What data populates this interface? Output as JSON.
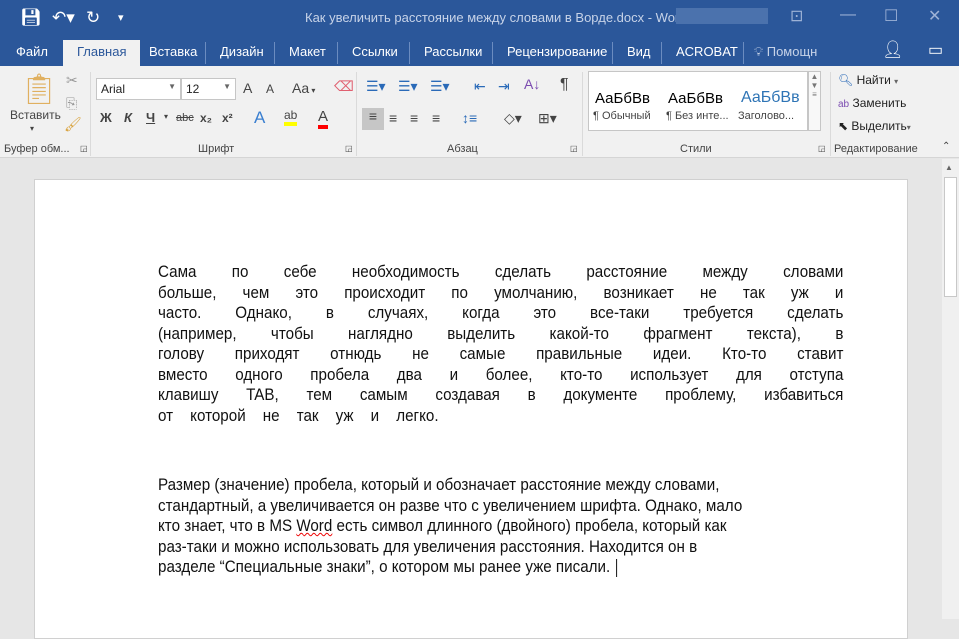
{
  "window": {
    "title": "Как увеличить расстояние между словами в Ворде.docx - Word"
  },
  "tabs": [
    "Файл",
    "Главная",
    "Вставка",
    "Дизайн",
    "Макет",
    "Ссылки",
    "Рассылки",
    "Рецензирование",
    "Вид",
    "ACROBAT",
    "Помощн"
  ],
  "active_tab": "Главная",
  "ribbon": {
    "clipboard": {
      "paste": "Вставить",
      "label": "Буфер обм..."
    },
    "font": {
      "name": "Arial",
      "size": "12",
      "label": "Шрифт",
      "bold": "Ж",
      "italic": "К",
      "underline": "Ч",
      "strike": "abc",
      "sub": "x₂",
      "sup": "x²",
      "case": "Aa",
      "grow": "A",
      "shrink": "A",
      "effects": "A",
      "highlight": "ab",
      "color": "A",
      "highlight_color": "#ffff00",
      "font_color": "#ff0000"
    },
    "paragraph": {
      "label": "Абзац"
    },
    "styles": {
      "label": "Стили",
      "items": [
        {
          "preview": "АаБбВв",
          "name": "¶ Обычный"
        },
        {
          "preview": "АаБбВв",
          "name": "¶ Без инте..."
        },
        {
          "preview": "АаБбВв",
          "name": "Заголово..."
        }
      ]
    },
    "editing": {
      "label": "Редактирование",
      "find": "Найти",
      "replace": "Заменить",
      "select": "Выделить"
    }
  },
  "document": {
    "paragraph1": [
      "Сама по себе необходимость сделать расстояние между словами",
      "больше, чем это происходит по умолчанию, возникает не так уж и",
      "часто. Однако, в случаях, когда это все-таки требуется сделать",
      "(например, чтобы наглядно выделить какой-то фрагмент текста), в",
      "голову приходят отнюдь не самые правильные идеи. Кто-то ставит",
      "вместо одного пробела два и более, кто-то использует для отступа",
      "клавишу TAB, тем самым создавая в документе проблему, избавиться",
      "от которой не так уж и легко."
    ],
    "paragraph2": {
      "l1": "Размер (значение) пробела, который и обозначает расстояние между словами,",
      "l2": "стандартный, а увеличивается он разве что с увеличением шрифта. Однако, мало",
      "l3a": "кто знает, что в MS ",
      "l3b": "Word",
      "l3c": " есть символ длинного (двойного) пробела, который как",
      "l4": "раз-таки и можно использовать для увеличения расстояния. Находится он в",
      "l5": "разделе “Специальные знаки”, о котором мы ранее уже писали."
    }
  }
}
